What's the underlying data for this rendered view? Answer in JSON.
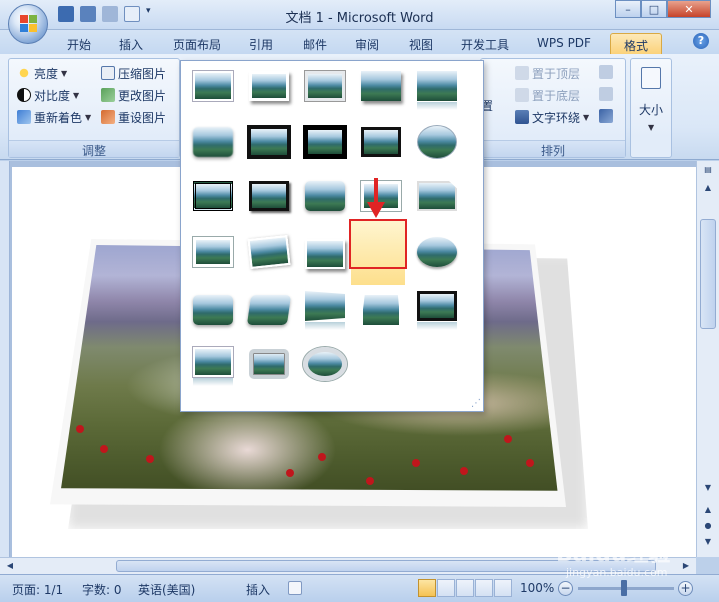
{
  "window": {
    "title": "文档 1 - Microsoft Word"
  },
  "tabs": [
    {
      "label": "开始"
    },
    {
      "label": "插入"
    },
    {
      "label": "页面布局"
    },
    {
      "label": "引用"
    },
    {
      "label": "邮件"
    },
    {
      "label": "审阅"
    },
    {
      "label": "视图"
    },
    {
      "label": "开发工具"
    },
    {
      "label": "WPS PDF"
    },
    {
      "label": "格式"
    }
  ],
  "ribbon": {
    "adjust": {
      "label": "调整",
      "brightness": "亮度",
      "contrast": "对比度",
      "recolor": "重新着色",
      "compress": "压缩图片",
      "change": "更改图片",
      "reset": "重设图片"
    },
    "arrange": {
      "label": "排列",
      "position_partial": "置",
      "bring_front": "置于顶层",
      "send_back": "置于底层",
      "text_wrap": "文字环绕"
    },
    "size": {
      "label": "大小"
    }
  },
  "status": {
    "page": "页面: 1/1",
    "words": "字数: 0",
    "language": "英语(美国)",
    "mode": "插入",
    "zoom": "100%"
  },
  "watermark": {
    "text": "Baidu经验",
    "sub": "jingyan.baidu.com"
  },
  "colors": {
    "highlight": "#e02424",
    "active_tab": "#fbd27a"
  }
}
